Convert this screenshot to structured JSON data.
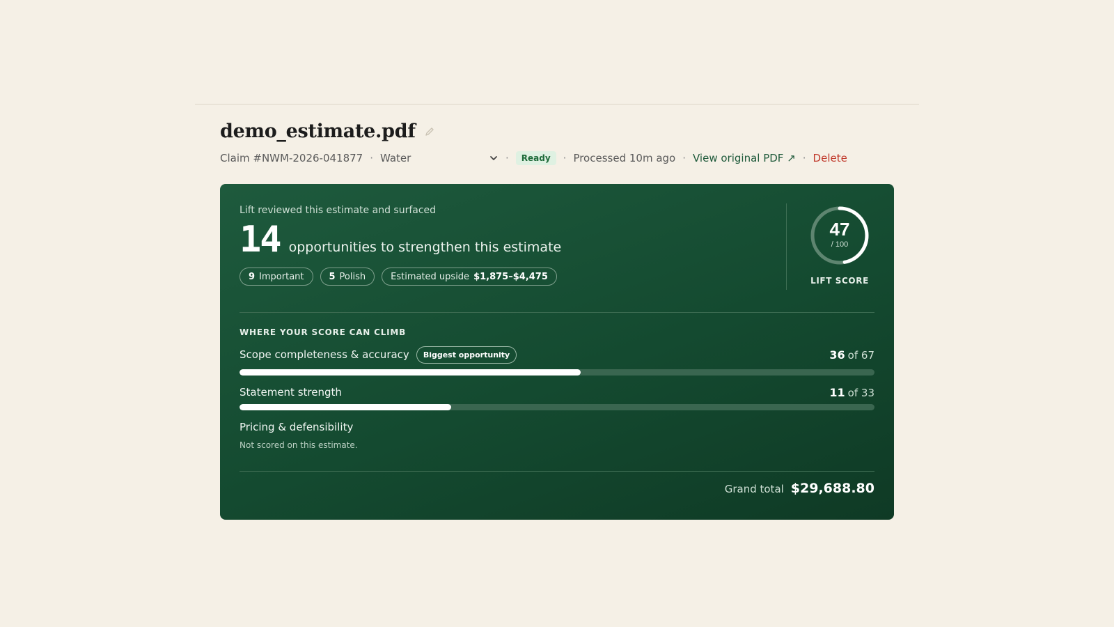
{
  "document": {
    "title": "demo_estimate.pdf",
    "claim": "Claim #NWM-2026-041877",
    "loss_type": "Water",
    "status": "Ready",
    "processed": "Processed 10m ago",
    "view_link": "View original PDF ↗",
    "delete_label": "Delete",
    "separator": "·"
  },
  "summary": {
    "intro": "Lift reviewed this estimate and surfaced",
    "count": "14",
    "caption": "opportunities to strengthen this estimate",
    "pills": {
      "important_count": "9",
      "important_label": "Important",
      "polish_count": "5",
      "polish_label": "Polish",
      "upside_label": "Estimated upside",
      "upside_value": "$1,875–$4,475"
    }
  },
  "score": {
    "value": 47,
    "value_text": "47",
    "max_text": "/ 100",
    "label": "LIFT SCORE"
  },
  "breakdown": {
    "title": "WHERE YOUR SCORE CAN CLIMB",
    "items": [
      {
        "name": "Scope completeness & accuracy",
        "tag": "Biggest opportunity",
        "score": "36",
        "of_text": "of 67",
        "fraction": 0.537
      },
      {
        "name": "Statement strength",
        "score": "11",
        "of_text": "of 33",
        "fraction": 0.333
      },
      {
        "name": "Pricing & defensibility",
        "note": "Not scored on this estimate."
      }
    ]
  },
  "totals": {
    "label": "Grand total",
    "value": "$29,688.80"
  },
  "colors": {
    "accent": "#1e5a3d",
    "status_bg": "#dff1e2",
    "delete": "#c0392b"
  }
}
